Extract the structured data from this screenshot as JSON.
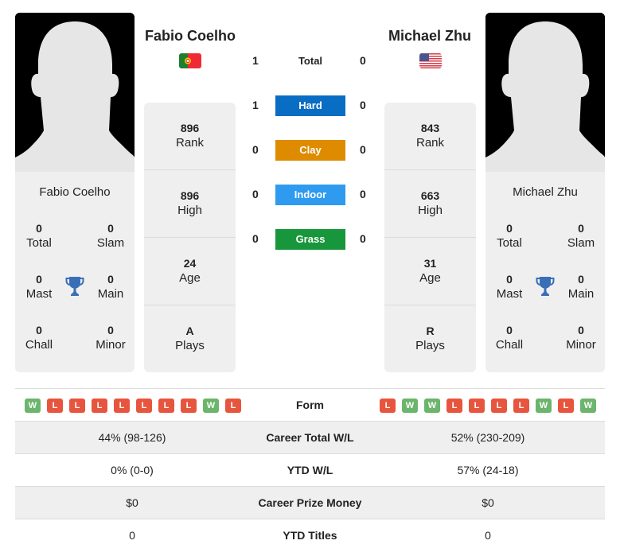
{
  "colors": {
    "hard": "#0a6dc4",
    "clay": "#df8b00",
    "indoor": "#2e9bf0",
    "grass": "#18963c",
    "win": "#6cb56c",
    "loss": "#e8553e",
    "trophy": "#3a6fb7"
  },
  "player_left": {
    "name": "Fabio Coelho",
    "flag": "portugal-flag",
    "titles": {
      "total": {
        "value": "0",
        "label": "Total"
      },
      "slam": {
        "value": "0",
        "label": "Slam"
      },
      "mast": {
        "value": "0",
        "label": "Mast"
      },
      "main": {
        "value": "0",
        "label": "Main"
      },
      "chall": {
        "value": "0",
        "label": "Chall"
      },
      "minor": {
        "value": "0",
        "label": "Minor"
      }
    },
    "stats": {
      "rank": {
        "value": "896",
        "label": "Rank"
      },
      "high": {
        "value": "896",
        "label": "High"
      },
      "age": {
        "value": "24",
        "label": "Age"
      },
      "plays": {
        "value": "A",
        "label": "Plays"
      }
    },
    "form": [
      "W",
      "L",
      "L",
      "L",
      "L",
      "L",
      "L",
      "L",
      "W",
      "L"
    ]
  },
  "player_right": {
    "name": "Michael Zhu",
    "flag": "usa-flag",
    "titles": {
      "total": {
        "value": "0",
        "label": "Total"
      },
      "slam": {
        "value": "0",
        "label": "Slam"
      },
      "mast": {
        "value": "0",
        "label": "Mast"
      },
      "main": {
        "value": "0",
        "label": "Main"
      },
      "chall": {
        "value": "0",
        "label": "Chall"
      },
      "minor": {
        "value": "0",
        "label": "Minor"
      }
    },
    "stats": {
      "rank": {
        "value": "843",
        "label": "Rank"
      },
      "high": {
        "value": "663",
        "label": "High"
      },
      "age": {
        "value": "31",
        "label": "Age"
      },
      "plays": {
        "value": "R",
        "label": "Plays"
      }
    },
    "form": [
      "L",
      "W",
      "W",
      "L",
      "L",
      "L",
      "L",
      "W",
      "L",
      "W"
    ]
  },
  "h2h": {
    "total": {
      "label": "Total",
      "left": "1",
      "right": "0"
    },
    "hard": {
      "label": "Hard",
      "left": "1",
      "right": "0"
    },
    "clay": {
      "label": "Clay",
      "left": "0",
      "right": "0"
    },
    "indoor": {
      "label": "Indoor",
      "left": "0",
      "right": "0"
    },
    "grass": {
      "label": "Grass",
      "left": "0",
      "right": "0"
    }
  },
  "comparison": {
    "form_label": "Form",
    "rows": [
      {
        "label": "Career Total W/L",
        "left": "44% (98-126)",
        "right": "52% (230-209)"
      },
      {
        "label": "YTD W/L",
        "left": "0% (0-0)",
        "right": "57% (24-18)"
      },
      {
        "label": "Career Prize Money",
        "left": "$0",
        "right": "$0"
      },
      {
        "label": "YTD Titles",
        "left": "0",
        "right": "0"
      }
    ]
  }
}
